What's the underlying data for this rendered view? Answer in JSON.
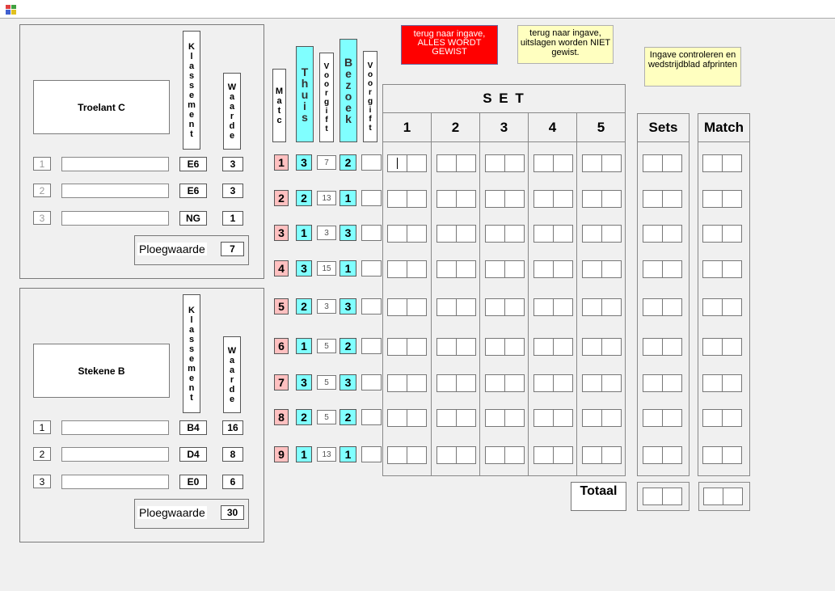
{
  "team1": {
    "name": "Troelant C",
    "klassement_header": "Klassement",
    "waarde_header": "Waarde",
    "players": [
      {
        "index": "1",
        "klassement": "E6",
        "waarde": "3"
      },
      {
        "index": "2",
        "klassement": "E6",
        "waarde": "3"
      },
      {
        "index": "3",
        "klassement": "NG",
        "waarde": "1"
      }
    ],
    "ploegwaarde_label": "Ploegwaarde",
    "ploegwaarde": "7"
  },
  "team2": {
    "name": "Stekene B",
    "klassement_header": "Klassement",
    "waarde_header": "Waarde",
    "players": [
      {
        "index": "1",
        "klassement": "B4",
        "waarde": "16"
      },
      {
        "index": "2",
        "klassement": "D4",
        "waarde": "8"
      },
      {
        "index": "3",
        "klassement": "E0",
        "waarde": "6"
      }
    ],
    "ploegwaarde_label": "Ploegwaarde",
    "ploegwaarde": "30"
  },
  "headers": {
    "match": "Matc",
    "thuis": "Thuis",
    "voorgift": "Voorgift",
    "bezoek": "Bezoek",
    "set": "S E T",
    "set_numbers": [
      "1",
      "2",
      "3",
      "4",
      "5"
    ],
    "sets": "Sets",
    "match_col": "Match",
    "totaal": "Totaal"
  },
  "buttons": {
    "reset_all": "terug naar ingave, ALLES WORDT GEWIST",
    "back_keep": "terug naar ingave, uitslagen worden NIET gewist.",
    "check_print": "Ingave controleren en wedstrijdblad afprinten"
  },
  "matches": [
    {
      "nr": "1",
      "thuis": "3",
      "voorgift": "7",
      "bezoek": "2"
    },
    {
      "nr": "2",
      "thuis": "2",
      "voorgift": "13",
      "bezoek": "1"
    },
    {
      "nr": "3",
      "thuis": "1",
      "voorgift": "3",
      "bezoek": "3"
    },
    {
      "nr": "4",
      "thuis": "3",
      "voorgift": "15",
      "bezoek": "1"
    },
    {
      "nr": "5",
      "thuis": "2",
      "voorgift": "3",
      "bezoek": "3"
    },
    {
      "nr": "6",
      "thuis": "1",
      "voorgift": "5",
      "bezoek": "2"
    },
    {
      "nr": "7",
      "thuis": "3",
      "voorgift": "5",
      "bezoek": "3"
    },
    {
      "nr": "8",
      "thuis": "2",
      "voorgift": "5",
      "bezoek": "2"
    },
    {
      "nr": "9",
      "thuis": "1",
      "voorgift": "13",
      "bezoek": "1"
    }
  ]
}
